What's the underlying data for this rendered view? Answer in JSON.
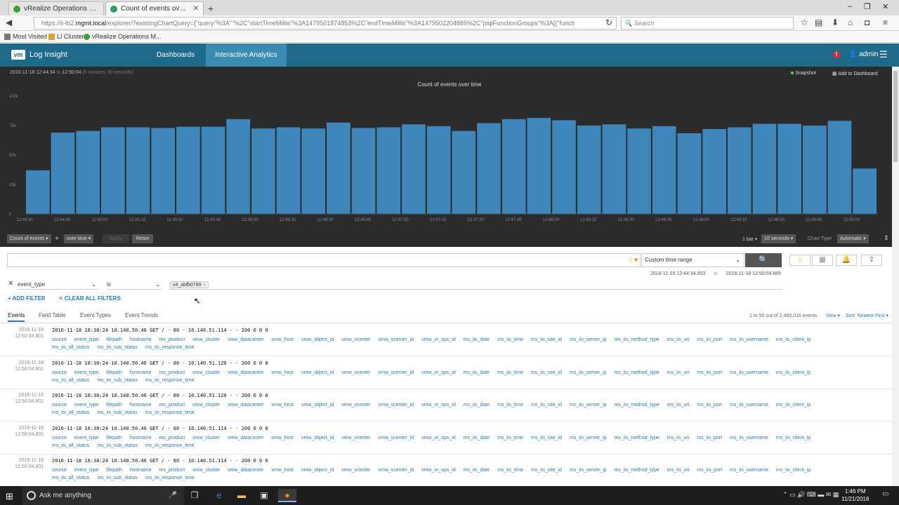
{
  "browser": {
    "tabs": [
      {
        "title": "vRealize Operations Mana..."
      },
      {
        "title": "Count of events over time..."
      }
    ],
    "new_tab": "+",
    "window_controls": {
      "min": "–",
      "max": "❐",
      "close": "✕"
    },
    "url_prefix": "https://li-lb2.",
    "url_host": "mgmt.local",
    "url_rest": "/explorer/?existingChartQuery={\"query\"%3A\"\"%2C\"startTimeMillis\"%3A1479501874853%2C\"endTimeMillis\"%3A1479502204885%2C\"piqlFunctionGroups\"%3A[{\"functi",
    "search_placeholder": "Search",
    "bookmarks": [
      "Most Visited",
      "LI Cluster",
      "vRealize Operations M..."
    ]
  },
  "app": {
    "logo": "vm",
    "title": "Log Insight",
    "nav": [
      "Dashboards",
      "Interactive Analytics"
    ],
    "alert_icon": "!",
    "user": "admin"
  },
  "chart_panel": {
    "range_date": "2016-11-18",
    "range_start": "12:44:34",
    "range_to": "to",
    "range_end": "12:50:04",
    "range_duration": "(5 minutes 30 seconds)",
    "snapshot": "Snapshot",
    "add_to_dashboard": "Add to Dashboard"
  },
  "chart_data": {
    "type": "bar",
    "title": "Count of events over time",
    "xlabel": "",
    "ylabel": "",
    "ylim": [
      0,
      100000
    ],
    "yticks": [
      "0",
      "25k",
      "50k",
      "75k",
      "100k"
    ],
    "xticks": [
      "12:44:30",
      "12:44:45",
      "12:45:00",
      "12:45:15",
      "12:45:30",
      "12:45:45",
      "12:46:00",
      "12:46:15",
      "12:46:30",
      "12:46:45",
      "12:47:00",
      "12:47:15",
      "12:47:30",
      "12:47:45",
      "12:48:00",
      "12:48:15",
      "12:48:30",
      "12:48:45",
      "12:49:00",
      "12:49:15",
      "12:49:30",
      "12:49:45",
      "12:50:00"
    ],
    "values": [
      37000,
      69000,
      70500,
      73500,
      73500,
      73000,
      74000,
      74000,
      80500,
      72500,
      73500,
      72500,
      77500,
      73000,
      73500,
      76000,
      74500,
      70500,
      77000,
      80500,
      81500,
      79500,
      75000,
      76000,
      72500,
      74500,
      68500,
      72000,
      73500,
      76500,
      76500,
      75000,
      79000,
      38500
    ],
    "color": "#3d87bc",
    "grid": false
  },
  "controls": {
    "count_btn": "Count of events ▾",
    "plus": "+",
    "overtime_btn": "over time ▾",
    "apply": "Apply",
    "reset": "Reset",
    "bar_label": "1 bar ▾",
    "interval": "10 seconds ▾",
    "chart_type_label": "Chart Type",
    "chart_type": "Automatic ▾"
  },
  "query": {
    "value": "",
    "time_range": "Custom time range",
    "start_ts": "2016-11-18  12:44:34.853",
    "to": "to",
    "end_ts": "2016-11-18  12:50:04.885"
  },
  "filter": {
    "field": "event_type",
    "operator": "is",
    "value": "v4_abfb0789",
    "add_filter": "+ ADD FILTER",
    "clear_filters": "✕ CLEAR ALL FILTERS"
  },
  "result_tabs": [
    "Events",
    "Field Table",
    "Event Types",
    "Event Trends"
  ],
  "result_count": "1 to 50 out of 2,466,016 events",
  "view_label": "View ▾",
  "sort_label": "Sort: Newest First ▾",
  "fields": [
    "source",
    "event_type",
    "filepath",
    "hostname",
    "ms_product",
    "vmw_cluster",
    "vmw_datacenter",
    "vmw_host",
    "vmw_object_id",
    "vmw_vcenter",
    "vmw_vcenter_id",
    "vmw_vr_ops_id",
    "ms_iis_date",
    "ms_iis_time",
    "ms_iis_site_id",
    "ms_iis_server_ip",
    "ms_iis_method_type",
    "ms_iis_uri",
    "ms_iis_port",
    "ms_iis_username",
    "ms_iis_client_ip",
    "ms_iis_all_status",
    "ms_iis_sub_status",
    "ms_iis_response_time"
  ],
  "events": [
    {
      "date": "2016-11-18",
      "time": "12:50:04.801",
      "text": "2016-11-18 18:30:24 10.140.50.46 GET / - 80 - 10.140.51.114 - - 200 0 0 0"
    },
    {
      "date": "2016-11-18",
      "time": "12:50:04.801",
      "text": "2016-11-18 18:30:24 10.140.50.46 GET / - 80 - 10.140.51.120 - - 200 0 0 0"
    },
    {
      "date": "2016-11-18",
      "time": "12:50:04.801",
      "text": "2016-11-18 18:30:24 10.140.50.46 GET / - 80 - 10.140.51.120 - - 200 0 0 0"
    },
    {
      "date": "2016-11-18",
      "time": "12:50:04.801",
      "text": "2016-11-18 18:30:24 10.140.50.46 GET / - 80 - 10.140.51.114 - - 200 0 0 0"
    },
    {
      "date": "2016-11-18",
      "time": "12:50:04.801",
      "text": "2016-11-18 18:30:24 10.140.50.46 GET / - 80 - 10.140.51.114 - - 200 0 0 0"
    }
  ],
  "taskbar": {
    "search": "Ask me anything",
    "time": "1:46 PM",
    "date": "11/21/2016"
  }
}
